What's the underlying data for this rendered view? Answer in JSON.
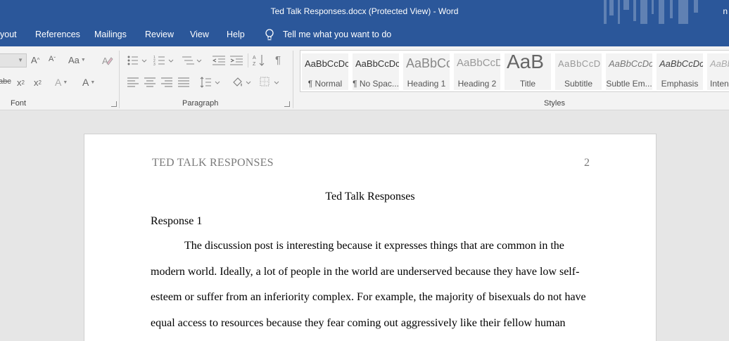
{
  "window": {
    "title": "Ted Talk Responses.docx (Protected View)  -  Word",
    "user_initial": "n"
  },
  "menu": {
    "items": [
      "yout",
      "References",
      "Mailings",
      "Review",
      "View",
      "Help"
    ],
    "tell_me": "Tell me what you want to do"
  },
  "ribbon": {
    "groups": {
      "font": "Font",
      "paragraph": "Paragraph",
      "styles": "Styles"
    },
    "font_buttons": {
      "grow": "A",
      "shrink": "A",
      "change_case": "Aa",
      "strikethrough": "abc",
      "subscript": "x",
      "superscript": "x",
      "text_effects": "A",
      "font_color": "A"
    },
    "styles": [
      {
        "preview": "AaBbCcDc",
        "name": "¶ Normal"
      },
      {
        "preview": "AaBbCcDc",
        "name": "¶ No Spac..."
      },
      {
        "preview": "AaBbCc",
        "name": "Heading 1"
      },
      {
        "preview": "AaBbCcD",
        "name": "Heading 2"
      },
      {
        "preview": "AaB",
        "name": "Title"
      },
      {
        "preview": "AaBbCcD",
        "name": "Subtitle"
      },
      {
        "preview": "AaBbCcDc",
        "name": "Subtle Em..."
      },
      {
        "preview": "AaBbCcDc",
        "name": "Emphasis"
      },
      {
        "preview": "AaBbCcDc",
        "name": "Inten"
      }
    ]
  },
  "document": {
    "running_head": "TED TALK RESPONSES",
    "page_number": "2",
    "title": "Ted Talk Responses",
    "section_heading": "Response 1",
    "lines": [
      "The discussion post is interesting because it expresses things that are common in the",
      "modern world. Ideally, a lot of people in the world are underserved because they have low self-",
      "esteem or suffer from an inferiority complex. For example, the majority of bisexuals do not have",
      "equal access to resources because they fear coming out aggressively like their fellow human"
    ]
  },
  "colors": {
    "titlebar": "#2b579a",
    "ribbon": "#f3f3f3",
    "workspace": "#e6e6e6",
    "page": "#ffffff"
  }
}
